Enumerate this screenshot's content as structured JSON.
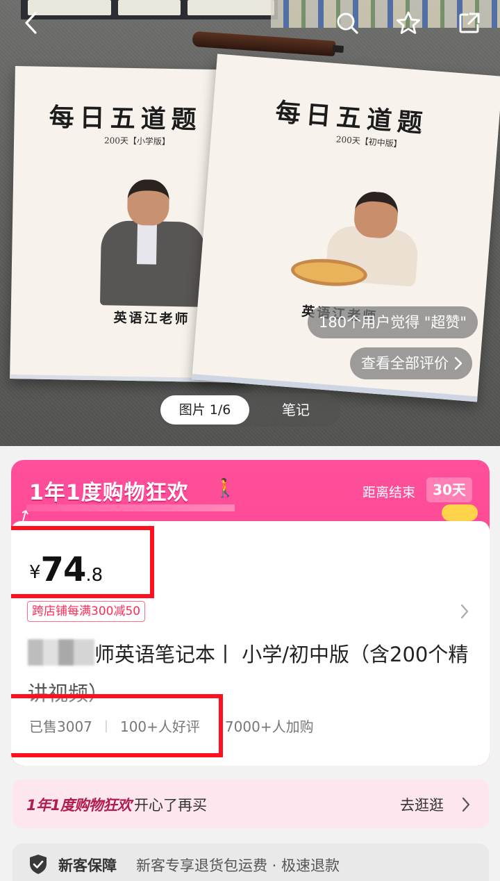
{
  "hero": {
    "books": {
      "left": {
        "title": "每日五道题",
        "subtitle": "200天【小学版】",
        "author": "英语江老师"
      },
      "right": {
        "title": "每日五道题",
        "subtitle": "200天【初中版】",
        "author": "英语江老师"
      }
    },
    "rating_text": "180个用户觉得 \"超赞\"",
    "reviews_link": "查看全部评价",
    "tabs": {
      "images": "图片 1/6",
      "notes": "笔记"
    }
  },
  "topbar": {
    "icons": [
      "back-arrow-icon",
      "search-icon",
      "star-icon",
      "share-icon"
    ]
  },
  "promo": {
    "event_title": "1年1度购物狂欢",
    "countdown_label": "距离结束",
    "countdown_value": "30天"
  },
  "product": {
    "price": {
      "currency": "¥",
      "integer": "74",
      "decimal": ".8"
    },
    "coupon": "跨店铺每满300减50",
    "title": "师英语笔记本丨 小学/初中版（含200个精讲视频）",
    "stats": {
      "sold": "已售3007",
      "reviews": "100+人好评",
      "carts": "7000+人加购"
    }
  },
  "event_strip": {
    "name": "1年1度购物狂欢",
    "slogan": "开心了再买",
    "cta": "去逛逛"
  },
  "guarantee": {
    "title": "新客保障",
    "desc": "新客专享退货包运费 · 极速退款"
  },
  "colors": {
    "promo_pink": "#ff4593",
    "highlight_red": "#ff1020",
    "coupon_red": "#ff2a55"
  }
}
